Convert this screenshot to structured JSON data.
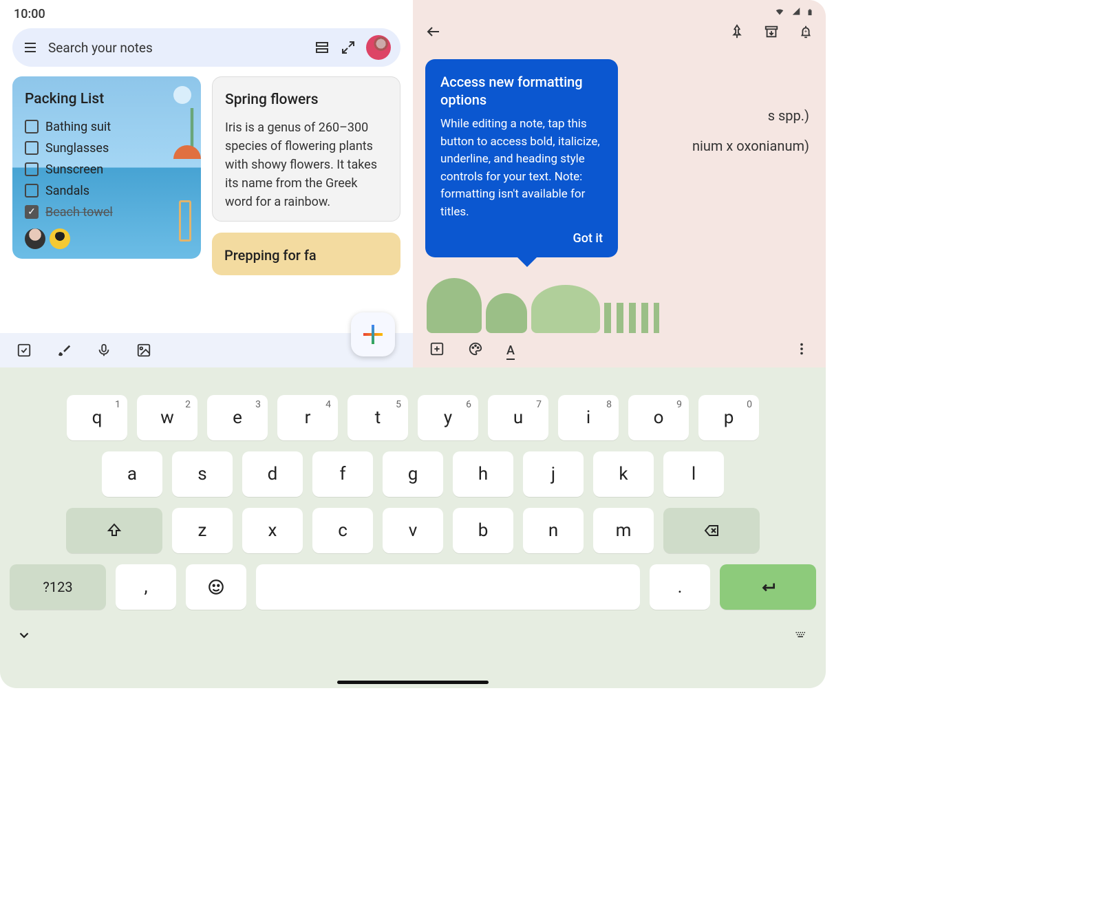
{
  "status": {
    "time": "10:00"
  },
  "left": {
    "search_placeholder": "Search your notes",
    "card_packing": {
      "title": "Packing List",
      "items": [
        {
          "label": "Bathing suit",
          "done": false
        },
        {
          "label": "Sunglasses",
          "done": false
        },
        {
          "label": "Sunscreen",
          "done": false
        },
        {
          "label": "Sandals",
          "done": false
        },
        {
          "label": "Beach towel",
          "done": true
        }
      ]
    },
    "card_flowers": {
      "title": "Spring flowers",
      "body": "Iris is a genus of 260–300 species of flowering plants with showy flowers. It takes its name from the Greek word for a rainbow."
    },
    "card_prep": {
      "title": "Prepping for fa"
    }
  },
  "right": {
    "note_lines": [
      "s spp.)",
      "nium x oxonianum)"
    ],
    "tooltip": {
      "title": "Access new formatting options",
      "body": "While editing a note, tap this button to access bold, italicize, underline, and heading style controls for your text. Note: formatting isn't available for titles.",
      "action": "Got it"
    }
  },
  "keyboard": {
    "row1": [
      {
        "k": "q",
        "s": "1"
      },
      {
        "k": "w",
        "s": "2"
      },
      {
        "k": "e",
        "s": "3"
      },
      {
        "k": "r",
        "s": "4"
      },
      {
        "k": "t",
        "s": "5"
      },
      {
        "k": "y",
        "s": "6"
      },
      {
        "k": "u",
        "s": "7"
      },
      {
        "k": "i",
        "s": "8"
      },
      {
        "k": "o",
        "s": "9"
      },
      {
        "k": "p",
        "s": "0"
      }
    ],
    "row2": [
      "a",
      "s",
      "d",
      "f",
      "g",
      "h",
      "j",
      "k",
      "l"
    ],
    "row3": [
      "z",
      "x",
      "c",
      "v",
      "b",
      "n",
      "m"
    ],
    "sym": "?123",
    "comma": ",",
    "period": "."
  }
}
